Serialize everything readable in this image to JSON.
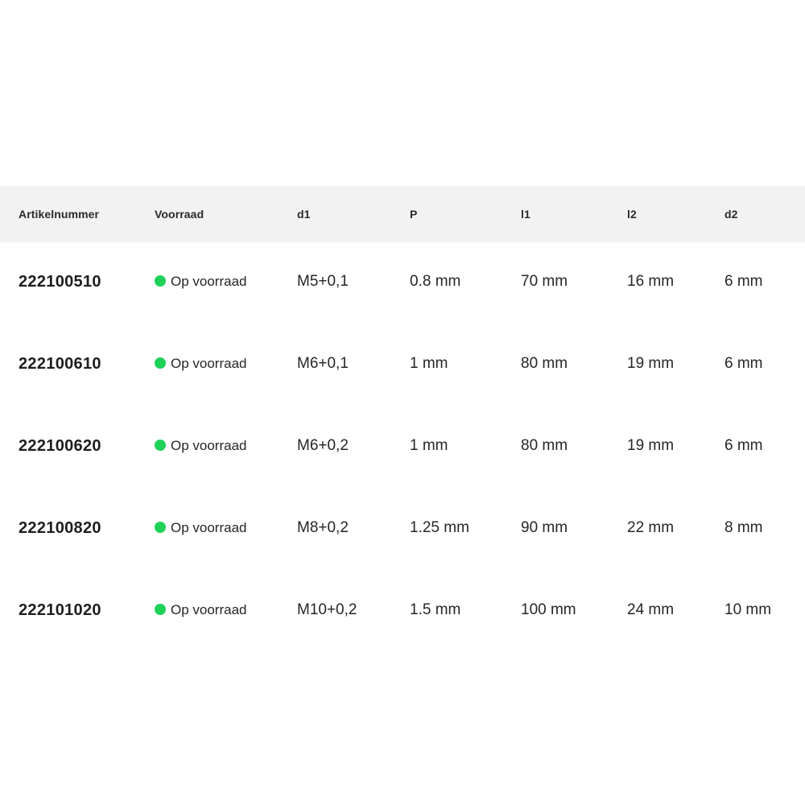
{
  "table": {
    "headers": [
      "Artikelnummer",
      "Voorraad",
      "d1",
      "P",
      "l1",
      "l2",
      "d2"
    ],
    "rows": [
      {
        "artikelnummer": "222100510",
        "voorraad": "Op voorraad",
        "d1": "M5+0,1",
        "p": "0.8 mm",
        "l1": "70 mm",
        "l2": "16 mm",
        "d2": "6 mm"
      },
      {
        "artikelnummer": "222100610",
        "voorraad": "Op voorraad",
        "d1": "M6+0,1",
        "p": "1 mm",
        "l1": "80 mm",
        "l2": "19 mm",
        "d2": "6 mm"
      },
      {
        "artikelnummer": "222100620",
        "voorraad": "Op voorraad",
        "d1": "M6+0,2",
        "p": "1 mm",
        "l1": "80 mm",
        "l2": "19 mm",
        "d2": "6 mm"
      },
      {
        "artikelnummer": "222100820",
        "voorraad": "Op voorraad",
        "d1": "M8+0,2",
        "p": "1.25 mm",
        "l1": "90 mm",
        "l2": "22 mm",
        "d2": "8 mm"
      },
      {
        "artikelnummer": "222101020",
        "voorraad": "Op voorraad",
        "d1": "M10+0,2",
        "p": "1.5 mm",
        "l1": "100 mm",
        "l2": "24 mm",
        "d2": "10 mm"
      }
    ]
  },
  "colors": {
    "header_bg": "#f2f2f2",
    "in_stock": "#1fd158",
    "text": "#262626"
  },
  "icons": {
    "stock_indicator": "green-dot-icon"
  }
}
